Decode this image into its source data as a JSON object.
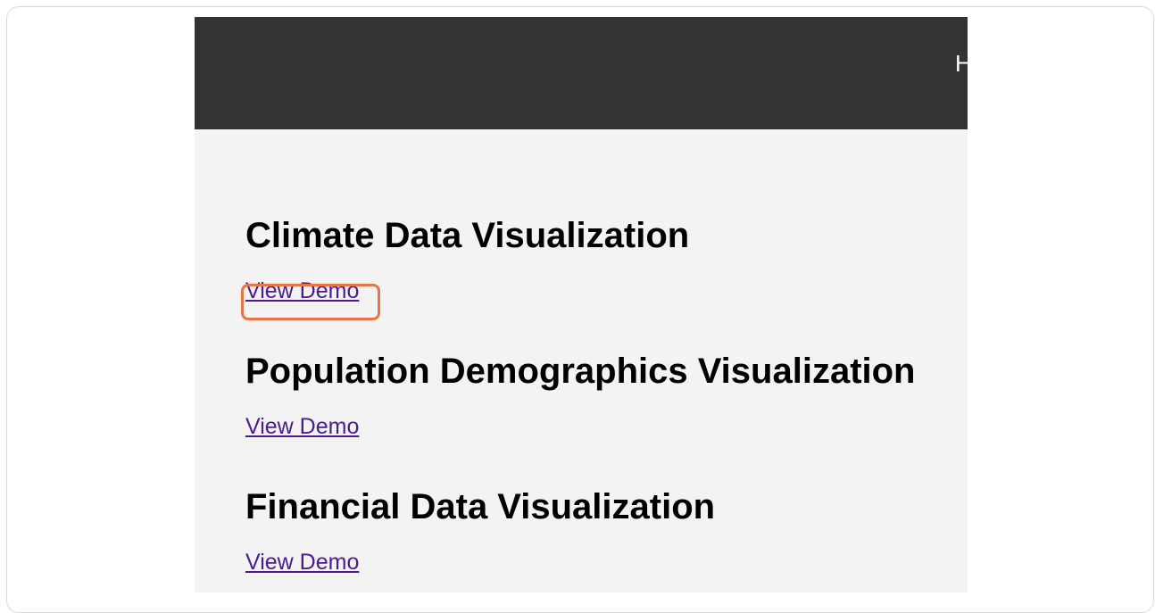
{
  "header": {
    "nav_text": "H"
  },
  "projects": [
    {
      "title": "Climate Data Visualization",
      "link_label": "View Demo"
    },
    {
      "title": "Population Demographics Visualization",
      "link_label": "View Demo"
    },
    {
      "title": "Financial Data Visualization",
      "link_label": "View Demo"
    }
  ],
  "colors": {
    "header_background": "#333333",
    "page_background": "#f3f3f3",
    "link": "#4b1a94",
    "highlight": "#ea7448"
  }
}
